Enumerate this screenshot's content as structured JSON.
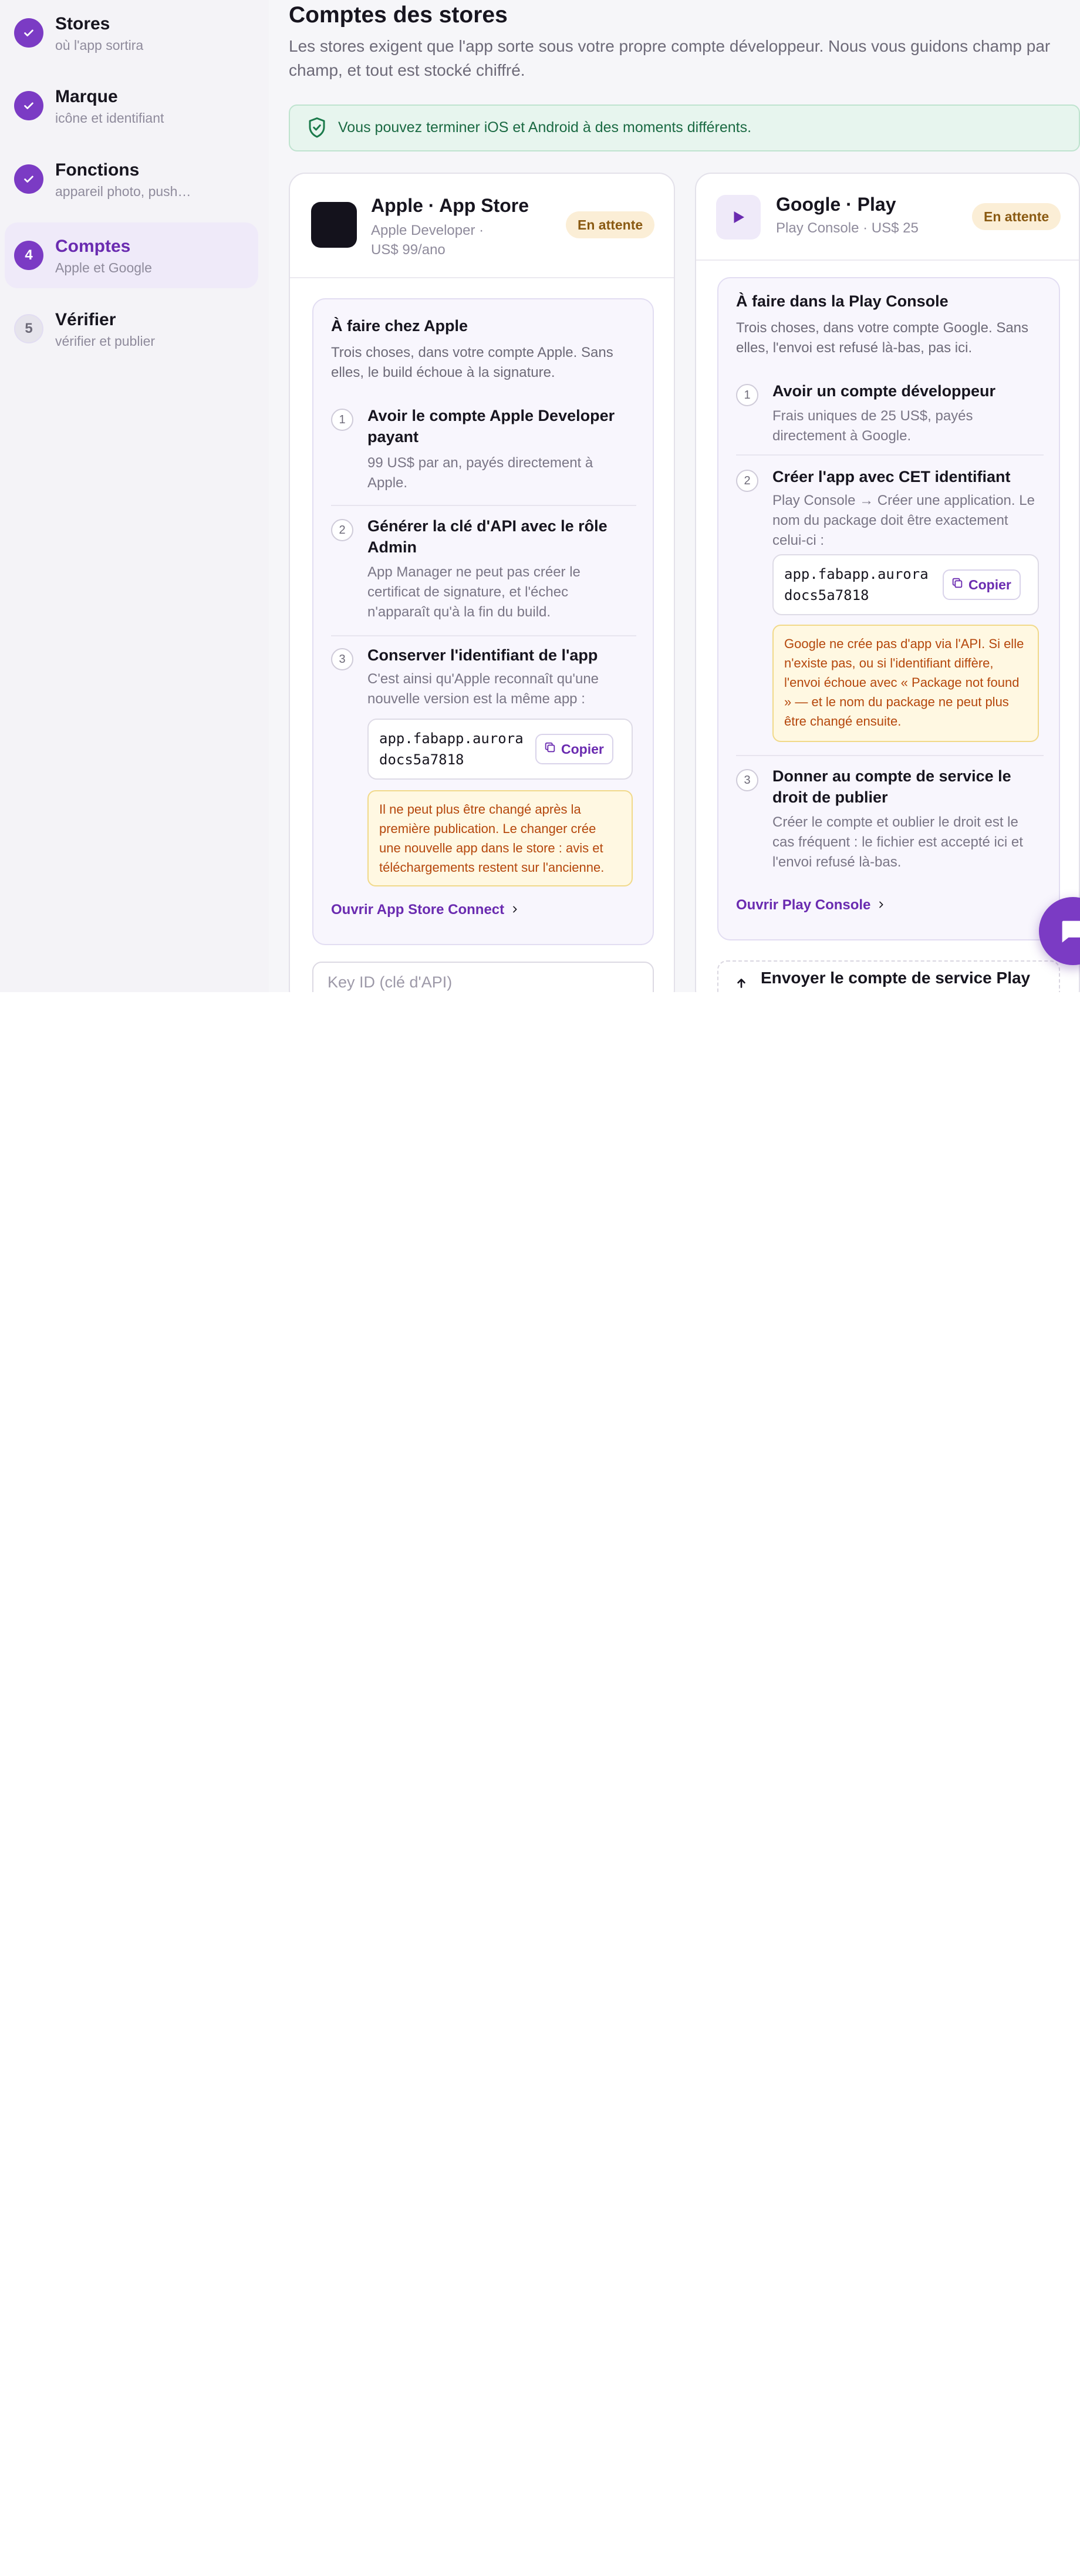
{
  "sidebar": {
    "steps": [
      {
        "number": "1",
        "title": "Stores",
        "subtitle": "où l'app sortira",
        "state": "done"
      },
      {
        "number": "2",
        "title": "Marque",
        "subtitle": "icône et identifiant",
        "state": "done"
      },
      {
        "number": "3",
        "title": "Fonctions",
        "subtitle": "appareil photo, push…",
        "state": "done"
      },
      {
        "number": "4",
        "title": "Comptes",
        "subtitle": "Apple et Google",
        "state": "current"
      },
      {
        "number": "5",
        "title": "Vérifier",
        "subtitle": "vérifier et publier",
        "state": "todo"
      }
    ]
  },
  "main": {
    "title": "Comptes des stores",
    "description": "Les stores exigent que l'app sorte sous votre propre compte développeur. Nous vous guidons champ par champ, et tout est stocké chiffré.",
    "banner": "Vous pouvez terminer iOS et Android à des moments différents."
  },
  "apple": {
    "name": "Apple · App Store",
    "subtitle": "Apple Developer · US$ 99/ano",
    "status": "En attente",
    "todo_title": "À faire chez Apple",
    "todo_desc": "Trois choses, dans votre compte Apple. Sans elles, le build échoue à la signature.",
    "steps": [
      {
        "n": "1",
        "title": "Avoir le compte Apple Developer payant",
        "desc": "99 US$ par an, payés directement à Apple."
      },
      {
        "n": "2",
        "title": "Générer la clé d'API avec le rôle Admin",
        "desc": "App Manager ne peut pas créer le certificat de signature, et l'échec n'apparaît qu'à la fin du build."
      },
      {
        "n": "3",
        "title": "Conserver l'identifiant de l'app",
        "desc": "C'est ainsi qu'Apple reconnaît qu'une nouvelle version est la même app :"
      }
    ],
    "bundle_id": "app.fabapp.aurora\ndocs5a7818",
    "copy_label": "Copier",
    "warning": "Il ne peut plus être changé après la première publication. Le changer crée une nouvelle app dans le store : avis et téléchargements restent sur l'ancienne.",
    "link": "Ouvrir App Store Connect",
    "key_placeholder": "Key ID (clé d'API)"
  },
  "google": {
    "name": "Google · Play",
    "subtitle": "Play Console · US$ 25",
    "status": "En attente",
    "todo_title": "À faire dans la Play Console",
    "todo_desc": "Trois choses, dans votre compte Google. Sans elles, l'envoi est refusé là-bas, pas ici.",
    "steps": [
      {
        "n": "1",
        "title": "Avoir un compte développeur",
        "desc": "Frais uniques de 25 US$, payés directement à Google."
      },
      {
        "n": "2",
        "title": "Créer l'app avec CET identifiant",
        "desc": "Play Console → Créer une application. Le nom du package doit être exactement celui-ci :"
      },
      {
        "n": "3",
        "title": "Donner au compte de service le droit de publier",
        "desc": "Créer le compte et oublier le droit est le cas fréquent : le fichier est accepté ici et l'envoi refusé là-bas."
      }
    ],
    "package_id": "app.fabapp.aurora\ndocs5a7818",
    "copy_label": "Copier",
    "warning": "Google ne crée pas d'app via l'API. Si elle n'existe pas, ou si l'identifiant diffère, l'envoi échoue avec « Package not found » — et le nom du package ne peut plus être changé ensuite.",
    "link": "Ouvrir Play Console",
    "upload_label": "Envoyer le compte de service Play"
  },
  "colors": {
    "accent": "#7b3bc4",
    "success_bg": "#e7f5ee",
    "warning_bg": "#fff8e2",
    "badge_bg": "#fbeed6"
  }
}
